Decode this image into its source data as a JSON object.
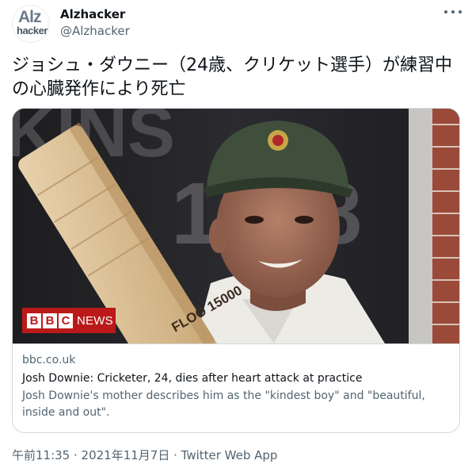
{
  "author": {
    "display_name": "Alzhacker",
    "handle": "@Alzhacker",
    "avatar_text_top": "Alz",
    "avatar_text_bottom": "hacker"
  },
  "tweet": {
    "text": "ジョシュ・ダウニー（24歳、クリケット選手）が練習中の心臓発作により死亡",
    "timestamp": "午前11:35 · 2021年11月7日 · Twitter Web App"
  },
  "card": {
    "domain": "bbc.co.uk",
    "title": "Josh Downie: Cricketer, 24, dies after heart attack at practice",
    "description": "Josh Downie's mother describes him as the \"kindest boy\" and \"beautiful, inside and out\".",
    "logo_letters": [
      "B",
      "B",
      "C"
    ],
    "logo_word": "NEWS",
    "bat_text": "FLOO 15000"
  },
  "colors": {
    "bbc_red": "#bb1919",
    "text_primary": "#0f1419",
    "text_secondary": "#536471",
    "border": "#cfd9de"
  },
  "icons": {
    "more": "more-horizontal-icon"
  }
}
